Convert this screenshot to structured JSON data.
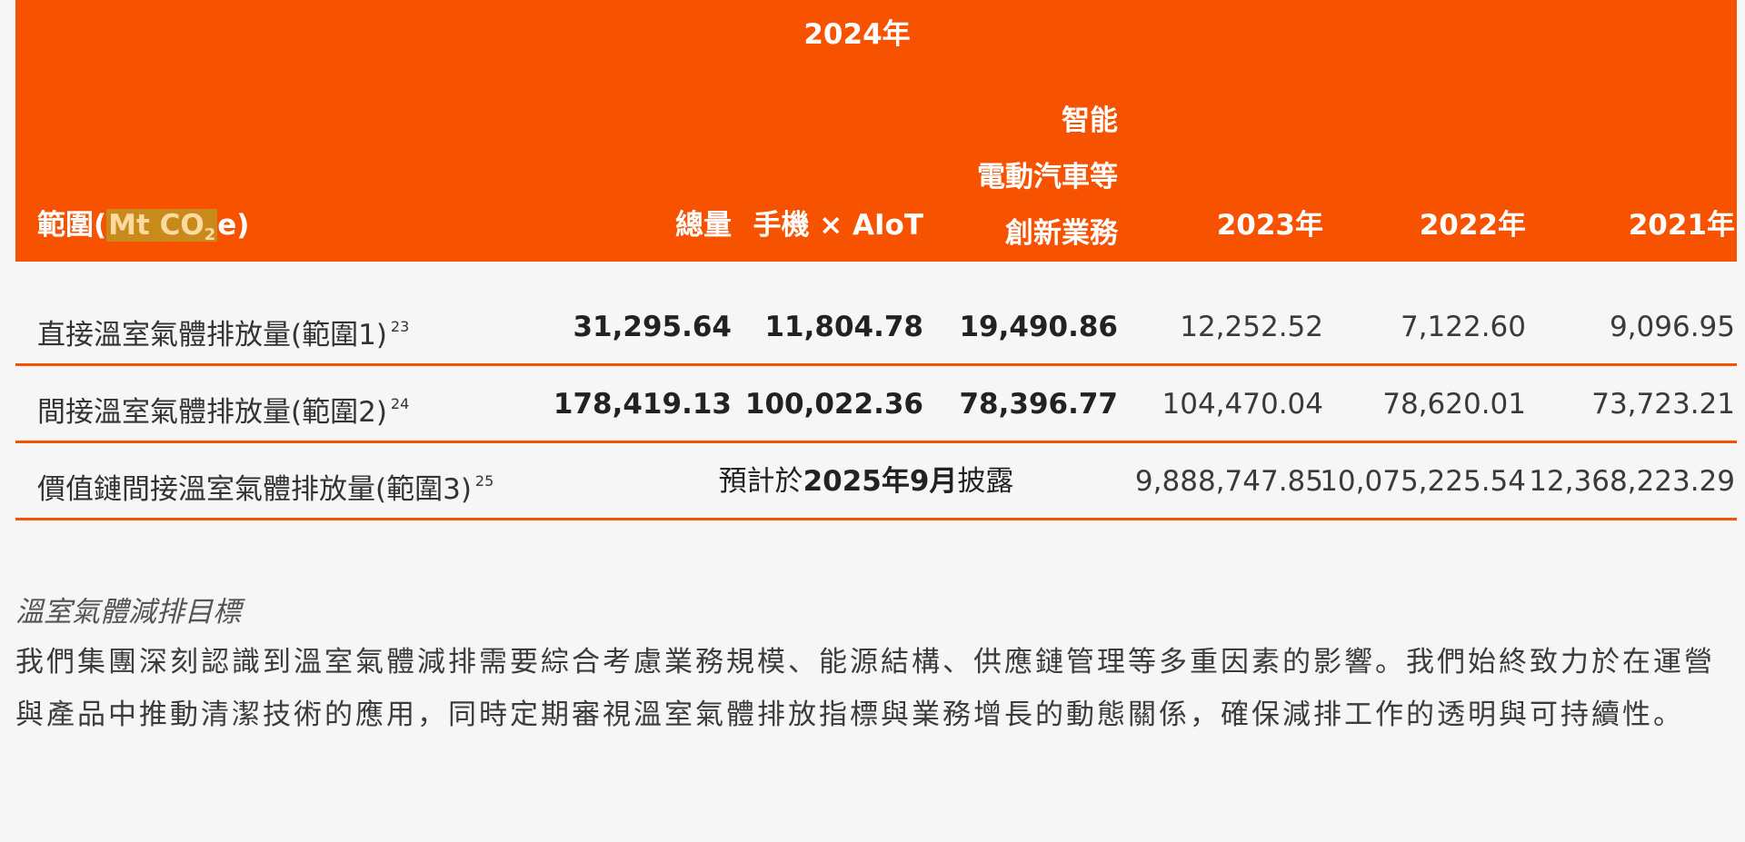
{
  "table": {
    "header": {
      "year_group": "2024年",
      "unit_label_prefix": "範圍(",
      "unit_label_unit": "Mt CO",
      "unit_label_sub": "2",
      "unit_label_suffix": "e)",
      "col_total": "總量",
      "col_phone_aiot": "手機 × AIoT",
      "col_ev_line1": "智能",
      "col_ev_line2": "電動汽車等",
      "col_ev_line3": "創新業務",
      "col_2023": "2023年",
      "col_2022": "2022年",
      "col_2021": "2021年"
    },
    "rows": [
      {
        "label": "直接溫室氣體排放量(範圍1)",
        "footnote": "23",
        "total": "31,295.64",
        "phone_aiot": "11,804.78",
        "ev_innovation": "19,490.86",
        "y2023": "12,252.52",
        "y2022": "7,122.60",
        "y2021": "9,096.95"
      },
      {
        "label": "間接溫室氣體排放量(範圍2)",
        "footnote": "24",
        "total": "178,419.13",
        "phone_aiot": "100,022.36",
        "ev_innovation": "78,396.77",
        "y2023": "104,470.04",
        "y2022": "78,620.01",
        "y2021": "73,723.21"
      },
      {
        "label": "價值鏈間接溫室氣體排放量(範圍3)",
        "footnote": "25",
        "merged_prefix": "預計於",
        "merged_num": "2025年9月",
        "merged_suffix": "披露",
        "y2023": "9,888,747.85",
        "y2022": "10,075,225.54",
        "y2021": "12,368,223.29"
      }
    ]
  },
  "section": {
    "title": "溫室氣體減排目標",
    "body": "我們集團深刻認識到溫室氣體減排需要綜合考慮業務規模、能源結構、供應鏈管理等多重因素的影響。我們始終致力於在運營與產品中推動清潔技術的應用，同時定期審視溫室氣體排放指標與業務增長的動態關係，確保減排工作的透明與可持續性。"
  },
  "colors": {
    "header_bg": "#f65200",
    "rule": "#f65200",
    "page_bg": "#f6f6f6"
  }
}
